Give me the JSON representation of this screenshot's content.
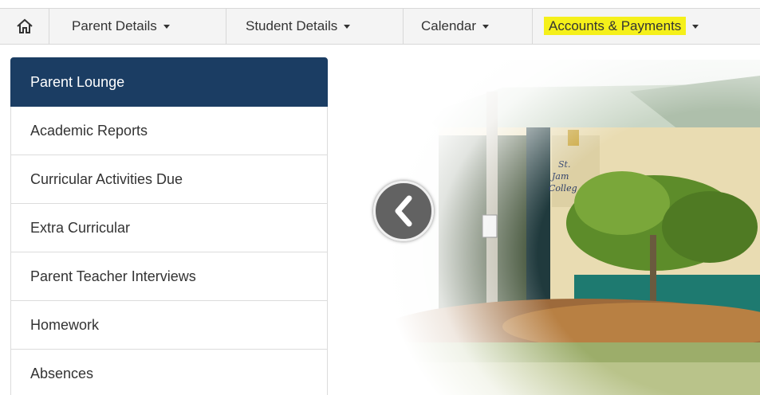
{
  "nav": {
    "home_icon": "home-icon",
    "items": [
      {
        "label": "Parent Details"
      },
      {
        "label": "Student Details"
      },
      {
        "label": "Calendar"
      },
      {
        "label": "Accounts & Payments"
      }
    ]
  },
  "sidebar": {
    "items": [
      {
        "label": "Parent Lounge",
        "active": true
      },
      {
        "label": "Academic Reports"
      },
      {
        "label": "Curricular Activities Due"
      },
      {
        "label": "Extra Curricular"
      },
      {
        "label": "Parent Teacher Interviews"
      },
      {
        "label": "Homework"
      },
      {
        "label": "Absences"
      }
    ]
  },
  "hero": {
    "sign_text": "St. James College",
    "prev_icon": "chevron-left-icon"
  },
  "colors": {
    "accent": "#1b3d63",
    "highlight": "#f5f01a"
  }
}
